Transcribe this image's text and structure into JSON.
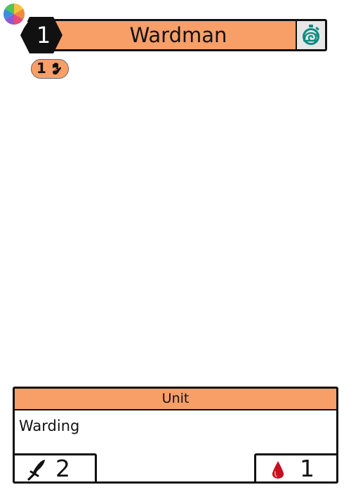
{
  "card": {
    "name": "Wardman",
    "cost": "1",
    "tag_value": "1",
    "type": "Unit",
    "rules_text": "Warding",
    "attack": "2",
    "health": "1"
  },
  "colors": {
    "accent": "#f89f68",
    "outline": "#111111",
    "timer_icon": "#0d8a80",
    "health_icon": "#c8101e"
  },
  "icons": {
    "logo": "color-wheel-icon",
    "cost": "lightning-bolt-icon",
    "timer": "stopwatch-snail-icon",
    "tag": "hand-icon",
    "attack": "sword-icon",
    "health": "blood-drop-icon"
  }
}
